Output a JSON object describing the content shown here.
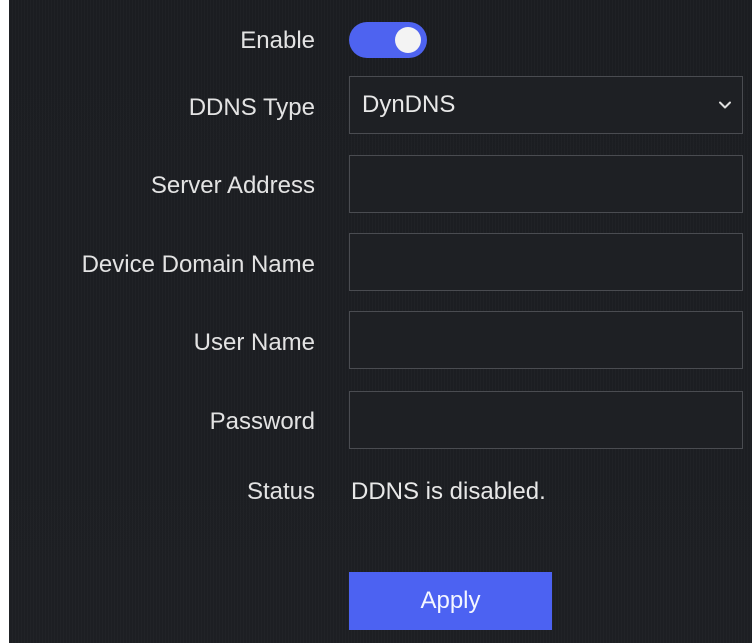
{
  "form": {
    "enable_label": "Enable",
    "enable_on": true,
    "ddns_type_label": "DDNS Type",
    "ddns_type_value": "DynDNS",
    "server_address_label": "Server Address",
    "server_address_value": "",
    "device_domain_label": "Device Domain Name",
    "device_domain_value": "",
    "user_name_label": "User Name",
    "user_name_value": "",
    "password_label": "Password",
    "password_value": "",
    "status_label": "Status",
    "status_value": "DDNS is disabled.",
    "apply_label": "Apply"
  },
  "icons": {
    "select_chevron": "chevron-down-icon"
  },
  "colors": {
    "accent": "#4e63f0",
    "panel_bg": "#1c1e22",
    "field_border": "#4a4c51",
    "text": "#e3e3e3"
  }
}
